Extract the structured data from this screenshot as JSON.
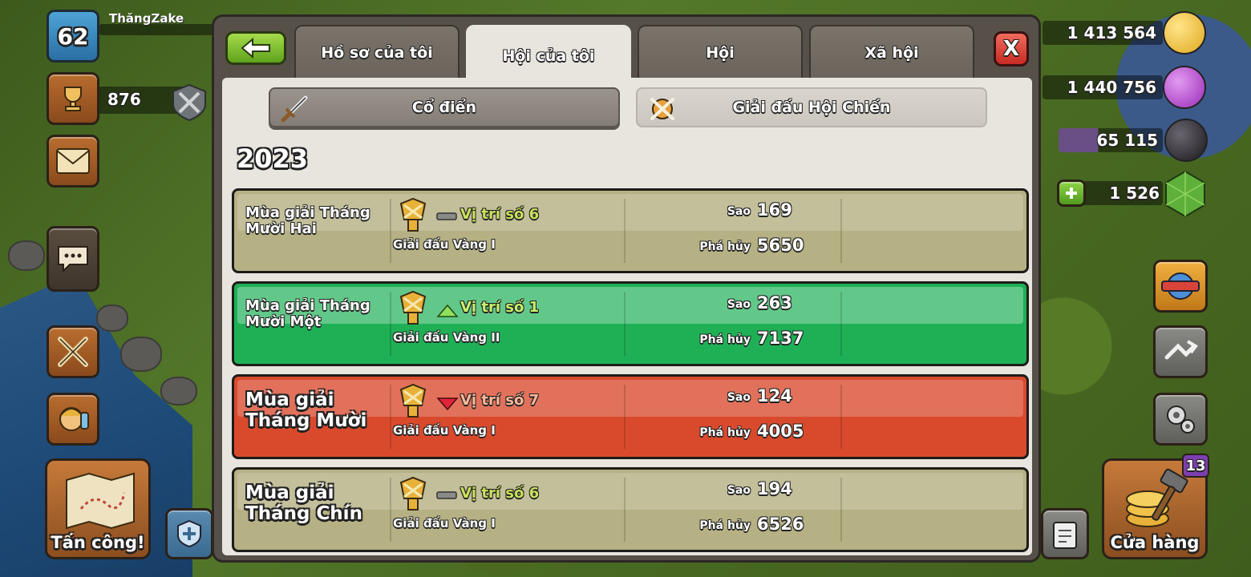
{
  "player": {
    "level": "62",
    "name": "ThăngZake",
    "trophies": "876"
  },
  "resources": {
    "gold": "1 413 564",
    "elixir": "1 440 756",
    "dark_elixir": "65 115",
    "gems": "1 526"
  },
  "buttons": {
    "attack": "Tấn công!",
    "shop": "Cửa hàng",
    "shop_badge": "13"
  },
  "tabs": [
    {
      "label": "Hồ sơ của tôi"
    },
    {
      "label": "Hội của tôi"
    },
    {
      "label": "Hội"
    },
    {
      "label": "Xã hội"
    }
  ],
  "close_label": "X",
  "segments": {
    "classic": "Cổ điển",
    "cwl": "Giải đấu Hội Chiến"
  },
  "year": "2023",
  "seasons": [
    {
      "name": "Mùa giải Tháng Mười Hai",
      "rank": "Vị trí số 6",
      "trend": "same",
      "league": "Giải đấu Vàng I",
      "stars_label": "Sao",
      "stars": "169",
      "destruction_label": "Phá hủy",
      "destruction": "5650",
      "style": "gray"
    },
    {
      "name": "Mùa giải Tháng Mười Một",
      "rank": "Vị trí số 1",
      "trend": "up",
      "league": "Giải đấu Vàng II",
      "stars_label": "Sao",
      "stars": "263",
      "destruction_label": "Phá hủy",
      "destruction": "7137",
      "style": "green"
    },
    {
      "name": "Mùa giải Tháng Mười",
      "rank": "Vị trí số 7",
      "trend": "down",
      "league": "Giải đấu Vàng I",
      "stars_label": "Sao",
      "stars": "124",
      "destruction_label": "Phá hủy",
      "destruction": "4005",
      "style": "red"
    },
    {
      "name": "Mùa giải Tháng Chín",
      "rank": "Vị trí số 6",
      "trend": "same",
      "league": "Giải đấu Vàng I",
      "stars_label": "Sao",
      "stars": "194",
      "destruction_label": "Phá hủy",
      "destruction": "6526",
      "style": "gray"
    }
  ],
  "colors": {
    "green_row": "#1fb056",
    "red_row": "#d94a2d",
    "gray_row": "#b5b184",
    "back_button": "#7cc232",
    "close_button": "#e0433a"
  }
}
